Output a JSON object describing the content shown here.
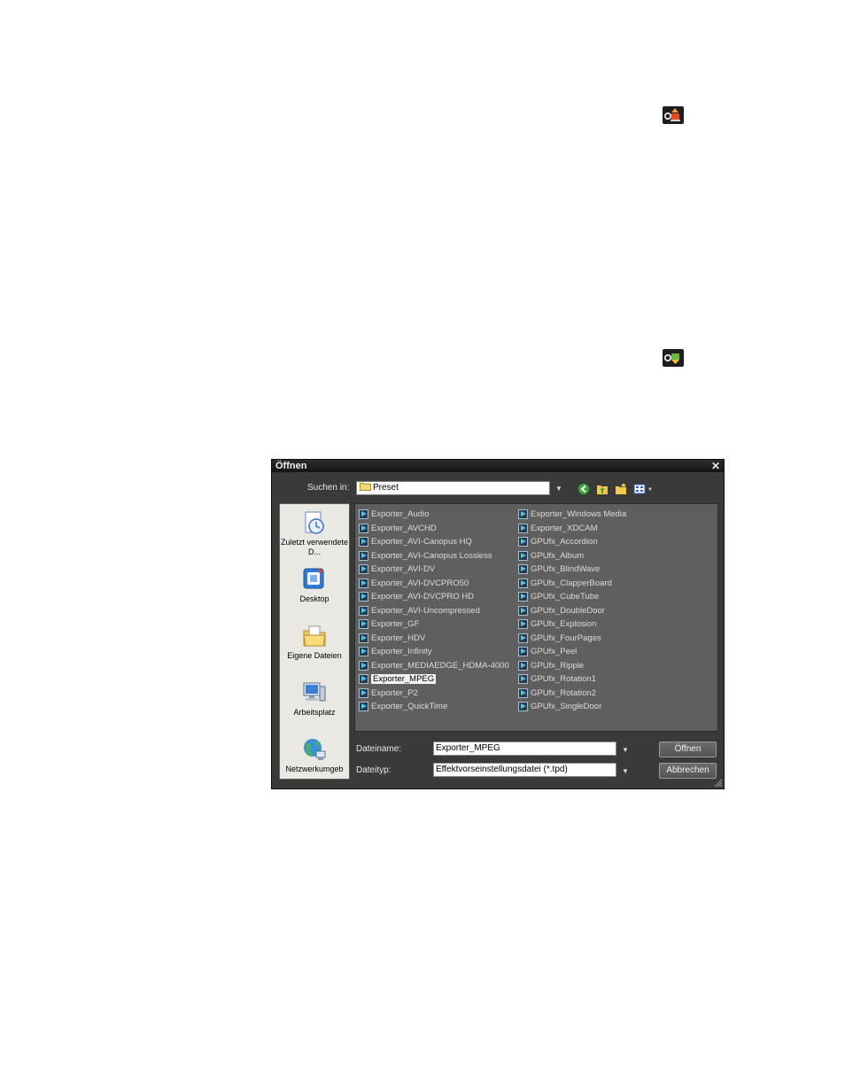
{
  "dialog": {
    "title": "Öffnen",
    "close_symbol": "✕",
    "look_in_label": "Suchen in:",
    "look_in_value": "Preset",
    "toolbar_icons": [
      "back-icon",
      "up-folder-icon",
      "new-folder-icon",
      "view-menu-icon"
    ],
    "places": [
      {
        "label": "Zuletzt verwendete D...",
        "icon": "recent-documents-icon"
      },
      {
        "label": "Desktop",
        "icon": "desktop-icon"
      },
      {
        "label": "Eigene Dateien",
        "icon": "my-documents-icon"
      },
      {
        "label": "Arbeitsplatz",
        "icon": "my-computer-icon"
      },
      {
        "label": "Netzwerkumgeb",
        "icon": "network-icon"
      }
    ],
    "files_col1": [
      "Exporter_Audio",
      "Exporter_AVCHD",
      "Exporter_AVI-Canopus HQ",
      "Exporter_AVI-Canopus Lossless",
      "Exporter_AVI-DV",
      "Exporter_AVI-DVCPRO50",
      "Exporter_AVI-DVCPRO HD",
      "Exporter_AVI-Uncompressed",
      "Exporter_GF",
      "Exporter_HDV",
      "Exporter_Infinity",
      "Exporter_MEDIAEDGE_HDMA-4000",
      "Exporter_MPEG",
      "Exporter_P2",
      "Exporter_QuickTime"
    ],
    "files_col2": [
      "Exporter_Windows Media",
      "Exporter_XDCAM",
      "GPUfx_Accordion",
      "GPUfx_Album",
      "GPUfx_BlindWave",
      "GPUfx_ClapperBoard",
      "GPUfx_CubeTube",
      "GPUfx_DoubleDoor",
      "GPUfx_Explosion",
      "GPUfx_FourPages",
      "GPUfx_Peel",
      "GPUfx_Ripple",
      "GPUfx_Rotation1",
      "GPUfx_Rotation2",
      "GPUfx_SingleDoor"
    ],
    "selected_file": "Exporter_MPEG",
    "filename_label": "Dateiname:",
    "filename_value": "Exporter_MPEG",
    "filetype_label": "Dateityp:",
    "filetype_value": "Effektvorseinstellungsdatei (*.tpd)",
    "open_button": "Öffnen",
    "cancel_button": "Abbrechen"
  },
  "page_icons": [
    "export-preset-icon",
    "import-preset-icon"
  ]
}
